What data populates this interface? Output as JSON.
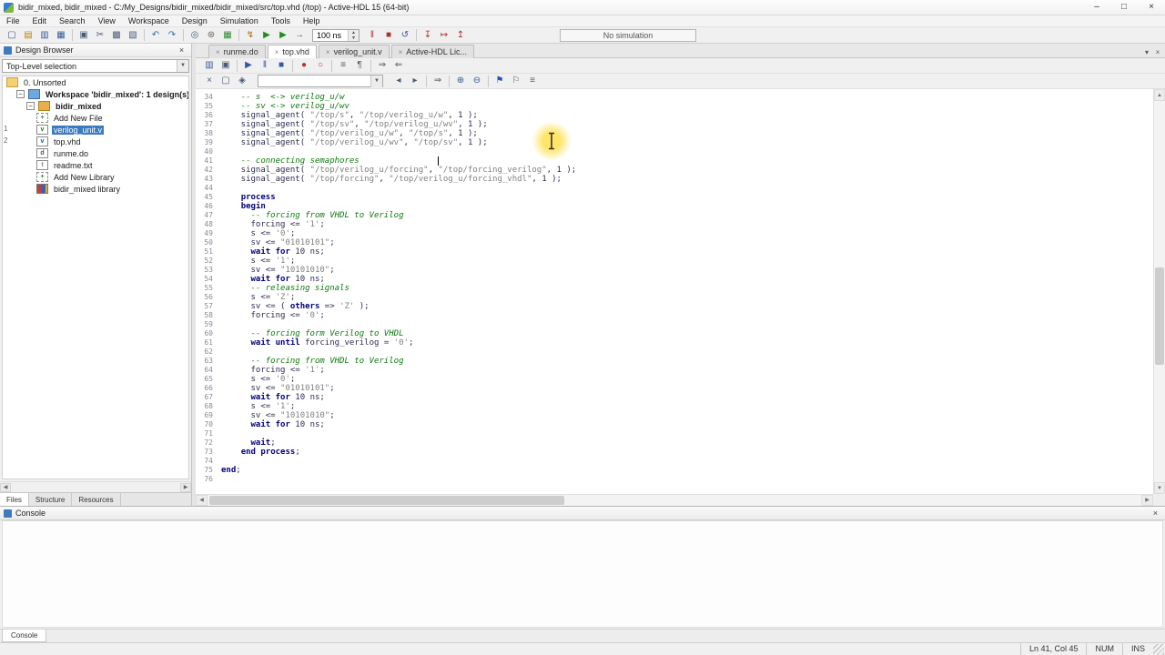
{
  "window": {
    "title": "bidir_mixed, bidir_mixed - C:/My_Designs/bidir_mixed/bidir_mixed/src/top.vhd (/top) - Active-HDL 15 (64-bit)",
    "minimize": "–",
    "maximize": "□",
    "close": "×"
  },
  "glyphs": {
    "close": "×",
    "dropdown": "▼",
    "up": "▲",
    "down": "▼",
    "left": "◀",
    "right": "▶"
  },
  "menu": [
    "File",
    "Edit",
    "Search",
    "View",
    "Workspace",
    "Design",
    "Simulation",
    "Tools",
    "Help"
  ],
  "main_toolbar": {
    "sim_time": "100 ns",
    "status": "No simulation",
    "icons_left": [
      {
        "name": "new-file-icon",
        "g": "▢"
      },
      {
        "name": "open-file-icon",
        "g": "▤",
        "c": "#b8860b"
      },
      {
        "name": "save-icon",
        "g": "▥",
        "c": "#33589c"
      },
      {
        "name": "save-all-icon",
        "g": "▦",
        "c": "#33589c"
      },
      {
        "sep": true
      },
      {
        "name": "print-icon",
        "g": "▣"
      },
      {
        "name": "cut-icon",
        "g": "✂"
      },
      {
        "name": "copy-icon",
        "g": "▩"
      },
      {
        "name": "paste-icon",
        "g": "▧"
      },
      {
        "sep": true
      },
      {
        "name": "undo-icon",
        "g": "↶",
        "c": "#2e6fb0"
      },
      {
        "name": "redo-icon",
        "g": "↷",
        "c": "#2e6fb0"
      },
      {
        "sep": true
      },
      {
        "name": "find-icon",
        "g": "◎"
      },
      {
        "name": "compile-icon",
        "g": "⊛",
        "c": "#666666"
      },
      {
        "name": "compile-all-icon",
        "g": "▦",
        "c": "#2e8b2e"
      },
      {
        "sep": true
      },
      {
        "name": "initialize-simulation-icon",
        "g": "↯",
        "c": "#b06a00"
      },
      {
        "name": "run-simulation-icon",
        "g": "▶",
        "c": "#1e8f1e"
      },
      {
        "name": "run-for-time-icon",
        "g": "▶",
        "c": "#1e8f1e"
      },
      {
        "name": "single-step-icon",
        "g": "→",
        "c": "#33589c"
      }
    ],
    "icons_right": [
      {
        "name": "pause-simulation-icon",
        "g": "‖",
        "c": "#b03030"
      },
      {
        "name": "stop-simulation-icon",
        "g": "■",
        "c": "#b03030"
      },
      {
        "name": "restart-simulation-icon",
        "g": "↺",
        "c": "#33589c"
      },
      {
        "sep": true
      },
      {
        "name": "trace-into-icon",
        "g": "↧",
        "c": "#b03030"
      },
      {
        "name": "trace-over-icon",
        "g": "↦",
        "c": "#b03030"
      },
      {
        "name": "trace-out-icon",
        "g": "↥",
        "c": "#b03030"
      }
    ]
  },
  "doc_tabs": [
    {
      "label": "runme.do"
    },
    {
      "label": "top.vhd",
      "active": true
    },
    {
      "label": "verilog_unit.v"
    },
    {
      "label": "Active-HDL Lic..."
    }
  ],
  "tab_strip_buttons": [
    {
      "name": "tab-list-icon",
      "g": "▾"
    },
    {
      "name": "close-document-icon",
      "g": "×"
    }
  ],
  "editor_toolbar_a": [
    {
      "name": "editor-save-icon",
      "g": "▥",
      "c": "#33589c"
    },
    {
      "name": "editor-print-icon",
      "g": "▣"
    },
    {
      "sep": true
    },
    {
      "name": "execute-macro-icon",
      "g": "▶",
      "c": "#33589c"
    },
    {
      "name": "pause-macro-icon",
      "g": "‖",
      "c": "#33589c"
    },
    {
      "name": "stop-macro-icon",
      "g": "■",
      "c": "#33589c"
    },
    {
      "sep": true
    },
    {
      "name": "toggle-breakpoint-icon",
      "g": "●",
      "c": "#c03030"
    },
    {
      "name": "clear-breakpoints-icon",
      "g": "○",
      "c": "#c03030"
    },
    {
      "sep": true
    },
    {
      "name": "comment-block-icon",
      "g": "≡",
      "c": "#555555"
    },
    {
      "name": "uncomment-block-icon",
      "g": "¶",
      "c": "#555555"
    },
    {
      "sep": true
    },
    {
      "name": "indent-icon",
      "g": "⇒",
      "c": "#555555"
    },
    {
      "name": "outdent-icon",
      "g": "⇐",
      "c": "#555555"
    }
  ],
  "editor_toolbar_b_left": [
    {
      "name": "search-close-icon",
      "g": "×"
    },
    {
      "name": "match-case-icon",
      "g": "▢"
    },
    {
      "name": "whole-word-icon",
      "g": "◈"
    }
  ],
  "editor_toolbar_b_right": [
    {
      "name": "find-previous-icon",
      "g": "◂"
    },
    {
      "name": "find-next-icon",
      "g": "▸"
    },
    {
      "sep": true
    },
    {
      "name": "goto-line-icon",
      "g": "⇒",
      "c": "#555555"
    },
    {
      "sep": true
    },
    {
      "name": "zoom-in-icon",
      "g": "⊕",
      "c": "#33589c"
    },
    {
      "name": "zoom-out-icon",
      "g": "⊖",
      "c": "#33589c"
    },
    {
      "sep": true
    },
    {
      "name": "bookmark-icon",
      "g": "⚑",
      "c": "#2255bb"
    },
    {
      "name": "next-bookmark-icon",
      "g": "⚐",
      "c": "#555555"
    },
    {
      "name": "document-outline-icon",
      "g": "≡",
      "c": "#555555"
    }
  ],
  "design_browser": {
    "title": "Design Browser",
    "top_level_label": "Top-Level selection",
    "tree": [
      {
        "label": "0. Unsorted",
        "indent": 0,
        "icon": "folder"
      },
      {
        "label": "Workspace 'bidir_mixed': 1 design(s)",
        "indent": 1,
        "icon": "workspace",
        "bold": true,
        "expander": "−"
      },
      {
        "label": "bidir_mixed",
        "indent": 2,
        "icon": "design",
        "bold": true,
        "expander": "−"
      },
      {
        "label": "Add New File",
        "indent": 3,
        "icon": "addfile",
        "letter": "+"
      },
      {
        "label": "verilog_unit.v",
        "indent": 3,
        "icon": "vfile",
        "letter": "v",
        "selected": true,
        "gutter": "1"
      },
      {
        "label": "top.vhd",
        "indent": 3,
        "icon": "vhdfile",
        "letter": "v",
        "gutter": "2"
      },
      {
        "label": "runme.do",
        "indent": 3,
        "icon": "dofile",
        "letter": "d"
      },
      {
        "label": "readme.txt",
        "indent": 3,
        "icon": "txtfile",
        "letter": "t"
      },
      {
        "label": "Add New Library",
        "indent": 3,
        "icon": "addlib",
        "letter": "+"
      },
      {
        "label": "bidir_mixed library",
        "indent": 3,
        "icon": "library"
      }
    ],
    "tabs": [
      {
        "label": "Files",
        "active": true
      },
      {
        "label": "Structure"
      },
      {
        "label": "Resources"
      }
    ]
  },
  "editor": {
    "lines": [
      {
        "n": 34,
        "s": [
          [
            "c",
            "    -- s  <-> verilog_u/w"
          ]
        ]
      },
      {
        "n": 35,
        "s": [
          [
            "c",
            "    -- sv <-> verilog_u/wv"
          ]
        ]
      },
      {
        "n": 36,
        "s": [
          [
            "p",
            "    signal_agent( "
          ],
          [
            "s",
            "\"/top/s\""
          ],
          [
            "p",
            ", "
          ],
          [
            "s",
            "\"/top/verilog_u/w\""
          ],
          [
            "p",
            ", 1 );"
          ]
        ]
      },
      {
        "n": 37,
        "s": [
          [
            "p",
            "    signal_agent( "
          ],
          [
            "s",
            "\"/top/sv\""
          ],
          [
            "p",
            ", "
          ],
          [
            "s",
            "\"/top/verilog_u/wv\""
          ],
          [
            "p",
            ", 1 );"
          ]
        ]
      },
      {
        "n": 38,
        "s": [
          [
            "p",
            "    signal_agent( "
          ],
          [
            "s",
            "\"/top/verilog_u/w\""
          ],
          [
            "p",
            ", "
          ],
          [
            "s",
            "\"/top/s\""
          ],
          [
            "p",
            ", 1 );"
          ]
        ]
      },
      {
        "n": 39,
        "s": [
          [
            "p",
            "    signal_agent( "
          ],
          [
            "s",
            "\"/top/verilog_u/wv\""
          ],
          [
            "p",
            ", "
          ],
          [
            "s",
            "\"/top/sv\""
          ],
          [
            "p",
            ", 1 );"
          ]
        ]
      },
      {
        "n": 40,
        "s": []
      },
      {
        "n": 41,
        "s": [
          [
            "c",
            "    -- connecting semaphores"
          ]
        ]
      },
      {
        "n": 42,
        "s": [
          [
            "p",
            "    signal_agent( "
          ],
          [
            "s",
            "\"/top/verilog_u/forcing\""
          ],
          [
            "p",
            ", "
          ],
          [
            "s",
            "\"/top/forcing_verilog\""
          ],
          [
            "p",
            ", 1 );"
          ]
        ]
      },
      {
        "n": 43,
        "s": [
          [
            "p",
            "    signal_agent( "
          ],
          [
            "s",
            "\"/top/forcing\""
          ],
          [
            "p",
            ", "
          ],
          [
            "s",
            "\"/top/verilog_u/forcing_vhdl\""
          ],
          [
            "p",
            ", 1 );"
          ]
        ]
      },
      {
        "n": 44,
        "s": []
      },
      {
        "n": 45,
        "s": [
          [
            "p",
            "    "
          ],
          [
            "k",
            "process"
          ]
        ]
      },
      {
        "n": 46,
        "s": [
          [
            "p",
            "    "
          ],
          [
            "k",
            "begin"
          ]
        ]
      },
      {
        "n": 47,
        "s": [
          [
            "c",
            "      -- forcing from VHDL to Verilog"
          ]
        ]
      },
      {
        "n": 48,
        "s": [
          [
            "p",
            "      forcing <= "
          ],
          [
            "s",
            "'1'"
          ],
          [
            "p",
            ";"
          ]
        ]
      },
      {
        "n": 49,
        "s": [
          [
            "p",
            "      s <= "
          ],
          [
            "s",
            "'0'"
          ],
          [
            "p",
            ";"
          ]
        ]
      },
      {
        "n": 50,
        "s": [
          [
            "p",
            "      sv <= "
          ],
          [
            "s",
            "\"01010101\""
          ],
          [
            "p",
            ";"
          ]
        ]
      },
      {
        "n": 51,
        "s": [
          [
            "p",
            "      "
          ],
          [
            "k",
            "wait"
          ],
          [
            "p",
            " "
          ],
          [
            "k",
            "for"
          ],
          [
            "p",
            " 10 ns;"
          ]
        ]
      },
      {
        "n": 52,
        "s": [
          [
            "p",
            "      s <= "
          ],
          [
            "s",
            "'1'"
          ],
          [
            "p",
            ";"
          ]
        ]
      },
      {
        "n": 53,
        "s": [
          [
            "p",
            "      sv <= "
          ],
          [
            "s",
            "\"10101010\""
          ],
          [
            "p",
            ";"
          ]
        ]
      },
      {
        "n": 54,
        "s": [
          [
            "p",
            "      "
          ],
          [
            "k",
            "wait"
          ],
          [
            "p",
            " "
          ],
          [
            "k",
            "for"
          ],
          [
            "p",
            " 10 ns;"
          ]
        ]
      },
      {
        "n": 55,
        "s": [
          [
            "c",
            "      -- releasing signals"
          ]
        ]
      },
      {
        "n": 56,
        "s": [
          [
            "p",
            "      s <= "
          ],
          [
            "s",
            "'Z'"
          ],
          [
            "p",
            ";"
          ]
        ]
      },
      {
        "n": 57,
        "s": [
          [
            "p",
            "      sv <= ( "
          ],
          [
            "k",
            "others"
          ],
          [
            "p",
            " => "
          ],
          [
            "s",
            "'Z'"
          ],
          [
            "p",
            " );"
          ]
        ]
      },
      {
        "n": 58,
        "s": [
          [
            "p",
            "      forcing <= "
          ],
          [
            "s",
            "'0'"
          ],
          [
            "p",
            ";"
          ]
        ]
      },
      {
        "n": 59,
        "s": []
      },
      {
        "n": 60,
        "s": [
          [
            "c",
            "      -- forcing form Verilog to VHDL"
          ]
        ]
      },
      {
        "n": 61,
        "s": [
          [
            "p",
            "      "
          ],
          [
            "k",
            "wait"
          ],
          [
            "p",
            " "
          ],
          [
            "k",
            "until"
          ],
          [
            "p",
            " forcing_verilog = "
          ],
          [
            "s",
            "'0'"
          ],
          [
            "p",
            ";"
          ]
        ]
      },
      {
        "n": 62,
        "s": []
      },
      {
        "n": 63,
        "s": [
          [
            "c",
            "      -- forcing from VHDL to Verilog"
          ]
        ]
      },
      {
        "n": 64,
        "s": [
          [
            "p",
            "      forcing <= "
          ],
          [
            "s",
            "'1'"
          ],
          [
            "p",
            ";"
          ]
        ]
      },
      {
        "n": 65,
        "s": [
          [
            "p",
            "      s <= "
          ],
          [
            "s",
            "'0'"
          ],
          [
            "p",
            ";"
          ]
        ]
      },
      {
        "n": 66,
        "s": [
          [
            "p",
            "      sv <= "
          ],
          [
            "s",
            "\"01010101\""
          ],
          [
            "p",
            ";"
          ]
        ]
      },
      {
        "n": 67,
        "s": [
          [
            "p",
            "      "
          ],
          [
            "k",
            "wait"
          ],
          [
            "p",
            " "
          ],
          [
            "k",
            "for"
          ],
          [
            "p",
            " 10 ns;"
          ]
        ]
      },
      {
        "n": 68,
        "s": [
          [
            "p",
            "      s <= "
          ],
          [
            "s",
            "'1'"
          ],
          [
            "p",
            ";"
          ]
        ]
      },
      {
        "n": 69,
        "s": [
          [
            "p",
            "      sv <= "
          ],
          [
            "s",
            "\"10101010\""
          ],
          [
            "p",
            ";"
          ]
        ]
      },
      {
        "n": 70,
        "s": [
          [
            "p",
            "      "
          ],
          [
            "k",
            "wait"
          ],
          [
            "p",
            " "
          ],
          [
            "k",
            "for"
          ],
          [
            "p",
            " 10 ns;"
          ]
        ]
      },
      {
        "n": 71,
        "s": []
      },
      {
        "n": 72,
        "s": [
          [
            "p",
            "      "
          ],
          [
            "k",
            "wait"
          ],
          [
            "p",
            ";"
          ]
        ]
      },
      {
        "n": 73,
        "s": [
          [
            "p",
            "    "
          ],
          [
            "k",
            "end"
          ],
          [
            "p",
            " "
          ],
          [
            "k",
            "process"
          ],
          [
            "p",
            ";"
          ]
        ]
      },
      {
        "n": 74,
        "s": []
      },
      {
        "n": 75,
        "s": [
          [
            "k",
            "end"
          ],
          [
            "p",
            ";"
          ]
        ]
      },
      {
        "n": 76,
        "s": []
      }
    ]
  },
  "console": {
    "title": "Console",
    "tab": "Console"
  },
  "status_bar": {
    "position": "Ln 41, Col 45",
    "num": "NUM",
    "ins": "INS"
  }
}
